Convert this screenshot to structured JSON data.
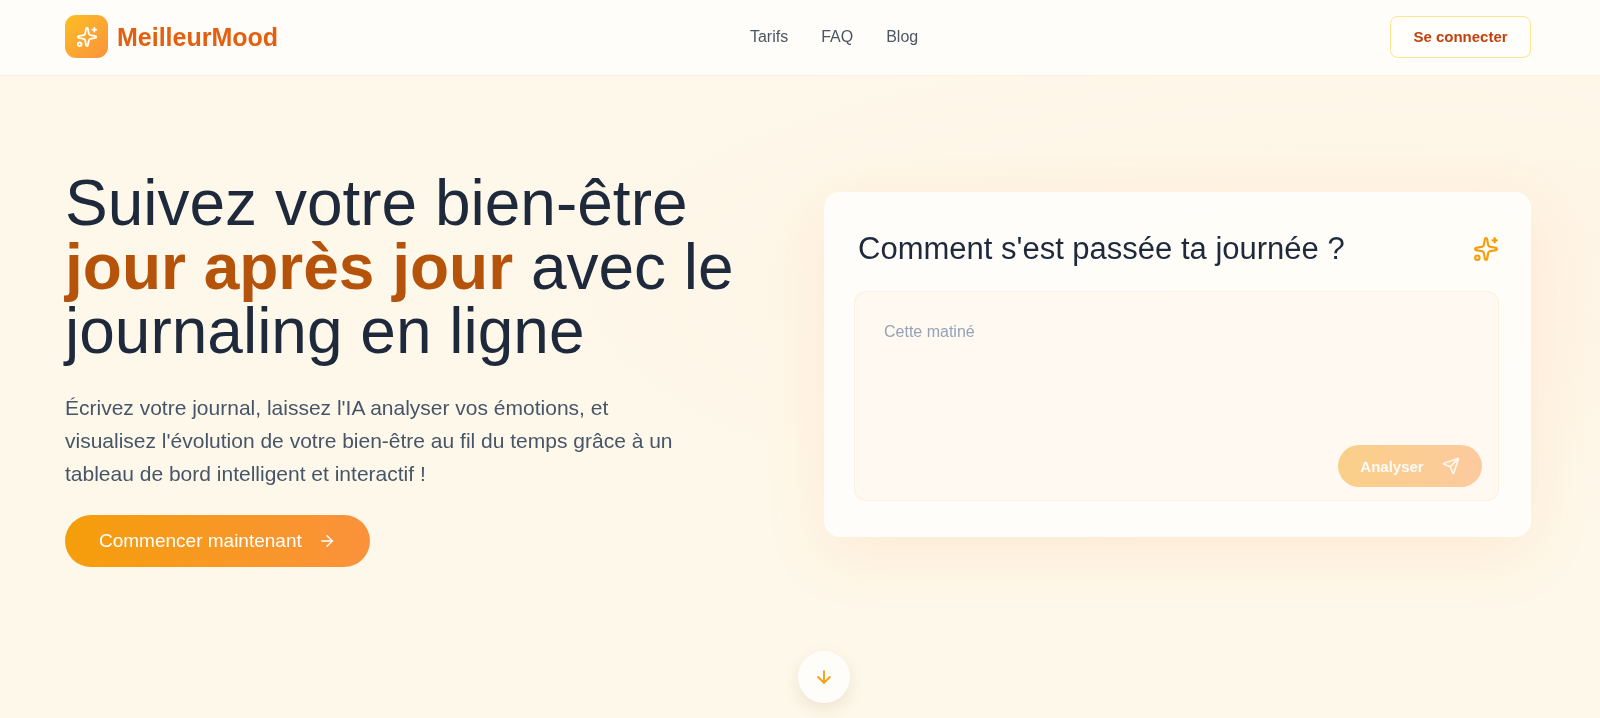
{
  "header": {
    "logo": {
      "name": "MeilleurMood"
    },
    "nav": [
      {
        "label": "Tarifs"
      },
      {
        "label": "FAQ"
      },
      {
        "label": "Blog"
      }
    ],
    "login_button": "Se connecter"
  },
  "hero": {
    "heading": "Suivez votre bien-être **jour après jour** avec le journaling en ligne",
    "description": "Écrivez votre journal, laissez l'IA analyser vos émotions, et visualisez l'évolution de votre bien-être au fil du temps grâce à un tableau de bord intelligent et interactif !",
    "cta_button": "Commencer maintenant"
  },
  "journal_card": {
    "title": "Comment s'est passée ta journée ?",
    "entry": {
      "placeholder": "Cette matiné"
    },
    "submit_button": {
      "label": "Analyser",
      "disabled": true
    }
  }
}
